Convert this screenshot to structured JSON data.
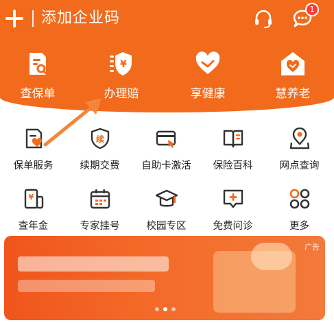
{
  "header": {
    "title": "添加企业码",
    "notification_count": "1",
    "icons": [
      "plus-icon",
      "headset-icon",
      "message-icon"
    ]
  },
  "top_nav": [
    {
      "label": "查保单",
      "icon": "policy-search-icon"
    },
    {
      "label": "办理赔",
      "icon": "claim-icon"
    },
    {
      "label": "享健康",
      "icon": "heart-icon"
    },
    {
      "label": "慧养老",
      "icon": "house-heart-icon"
    }
  ],
  "grid": [
    {
      "label": "保单服务",
      "icon": "policy-service-icon"
    },
    {
      "label": "续期交费",
      "icon": "renewal-shield-icon"
    },
    {
      "label": "自助卡激活",
      "icon": "card-activate-icon"
    },
    {
      "label": "保险百科",
      "icon": "book-icon"
    },
    {
      "label": "网点查询",
      "icon": "location-pin-icon"
    },
    {
      "label": "查年金",
      "icon": "annuity-icon"
    },
    {
      "label": "专家挂号",
      "icon": "calendar-icon"
    },
    {
      "label": "校园专区",
      "icon": "graduation-cap-icon"
    },
    {
      "label": "免费问诊",
      "icon": "consult-icon"
    },
    {
      "label": "更多",
      "icon": "more-grid-icon"
    }
  ],
  "banner": {
    "ad_label": "广告",
    "page_count": 3,
    "active_page": 2
  },
  "colors": {
    "brand": "#f26a1b",
    "icon_dark": "#333333",
    "icon_accent": "#f26a1b"
  }
}
